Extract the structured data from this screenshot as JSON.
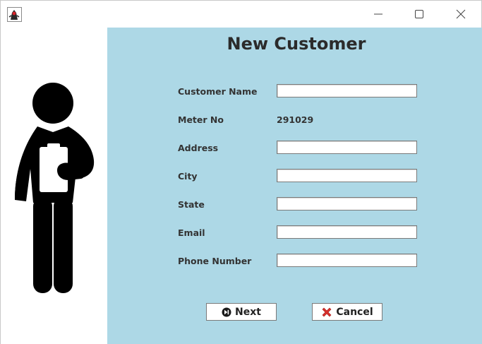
{
  "window": {
    "app_icon": "java-duke-icon",
    "controls": [
      "minimize-icon",
      "maximize-icon",
      "close-icon"
    ]
  },
  "illustration": "person-with-clipboard",
  "form": {
    "title": "New Customer",
    "fields": [
      {
        "label": "Customer Name",
        "value": ""
      },
      {
        "label": "Meter No",
        "value": "291029"
      },
      {
        "label": "Address",
        "value": ""
      },
      {
        "label": "City",
        "value": ""
      },
      {
        "label": "State",
        "value": ""
      },
      {
        "label": "Email",
        "value": ""
      },
      {
        "label": "Phone Number",
        "value": ""
      }
    ]
  },
  "buttons": {
    "next": {
      "label": "Next",
      "icon": "next-icon"
    },
    "cancel": {
      "label": "Cancel",
      "icon": "cancel-x-icon"
    }
  },
  "colors": {
    "panel_background": "#add8e6",
    "cancel_icon": "#d9302c"
  }
}
